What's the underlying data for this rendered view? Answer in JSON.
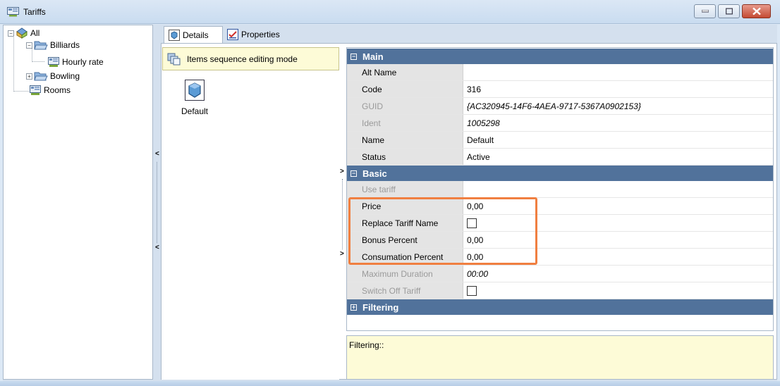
{
  "window": {
    "title": "Tariffs",
    "icon": "tariff-icon"
  },
  "tree": {
    "nodes": [
      {
        "label": "All",
        "icon": "tariff-group-icon",
        "expander": "−"
      },
      {
        "label": "Billiards",
        "icon": "folder-open-icon",
        "expander": "−"
      },
      {
        "label": "Hourly rate",
        "icon": "tariff-icon"
      },
      {
        "label": "Bowling",
        "icon": "folder-open-icon",
        "expander": "+"
      },
      {
        "label": "Rooms",
        "icon": "tariff-icon"
      }
    ]
  },
  "tabs": [
    {
      "label": "Details",
      "icon": "details-icon"
    },
    {
      "label": "Properties",
      "icon": "properties-icon"
    }
  ],
  "mode_bar": {
    "label": "Items sequence editing mode"
  },
  "items": [
    {
      "label": "Default",
      "icon": "tariff-item-icon"
    }
  ],
  "property_grid": {
    "categories": [
      {
        "name": "Main",
        "expanded": true,
        "rows": [
          {
            "name": "Alt Name",
            "value": "",
            "disabled": false
          },
          {
            "name": "Code",
            "value": "316",
            "disabled": false
          },
          {
            "name": "GUID",
            "value": "{AC320945-14F6-4AEA-9717-5367A0902153}",
            "disabled": true
          },
          {
            "name": "Ident",
            "value": "1005298",
            "disabled": true
          },
          {
            "name": "Name",
            "value": "Default",
            "disabled": false
          },
          {
            "name": "Status",
            "value": "Active",
            "disabled": false
          }
        ]
      },
      {
        "name": "Basic",
        "expanded": true,
        "rows": [
          {
            "name": "Use tariff",
            "value": "",
            "disabled": true
          },
          {
            "name": "Price",
            "value": "0,00",
            "disabled": false
          },
          {
            "name": "Replace Tariff Name",
            "checkbox": false,
            "disabled": false
          },
          {
            "name": "Bonus Percent",
            "value": "0,00",
            "disabled": false
          },
          {
            "name": "Consumation Percent",
            "value": "0,00",
            "disabled": false
          },
          {
            "name": "Maximum Duration",
            "value": "00:00",
            "disabled": true
          },
          {
            "name": "Switch Off Tariff",
            "checkbox": false,
            "disabled": true
          }
        ]
      },
      {
        "name": "Filtering",
        "expanded": false,
        "rows": []
      }
    ]
  },
  "description": {
    "text": "Filtering::"
  },
  "colors": {
    "category_header": "#51729b",
    "highlight": "#f07f40",
    "info_bg": "#fdfbd7"
  }
}
